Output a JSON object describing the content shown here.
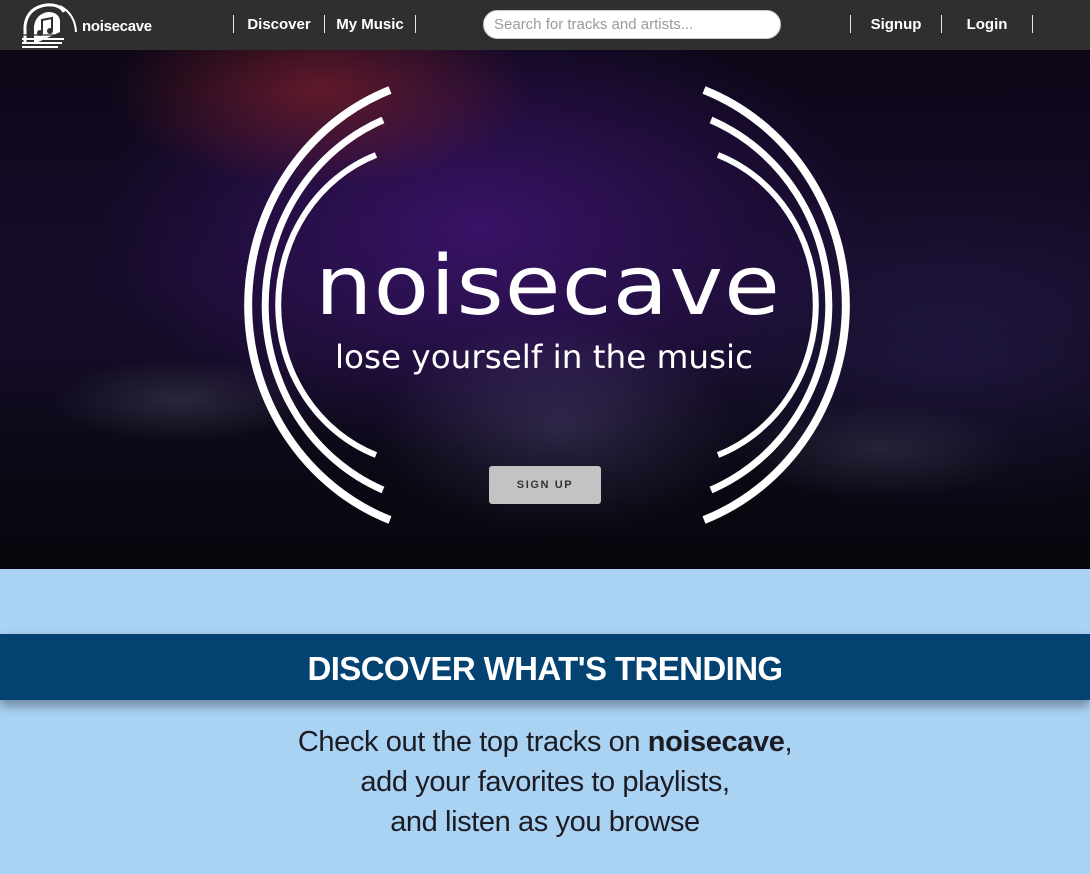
{
  "navbar": {
    "brand": "noisecave",
    "links": [
      "Discover",
      "My Music"
    ],
    "search": {
      "placeholder": "Search for tracks and artists..."
    },
    "auth": [
      "Signup",
      "Login"
    ]
  },
  "hero": {
    "logo_title": "noisecave",
    "logo_tagline": "lose yourself in the music",
    "cta_label": "SIGN UP"
  },
  "trending": {
    "heading": "DISCOVER WHAT'S TRENDING",
    "line1_prefix": "Check out the top tracks on ",
    "line1_brand": "noisecave",
    "line1_suffix": ",",
    "line2": "add your favorites to playlists,",
    "line3": "and listen as you browse"
  },
  "colors": {
    "navbar_bg": "#2f2f2f",
    "section_bg": "#aad2f3",
    "trend_bar_bg": "#044271"
  }
}
